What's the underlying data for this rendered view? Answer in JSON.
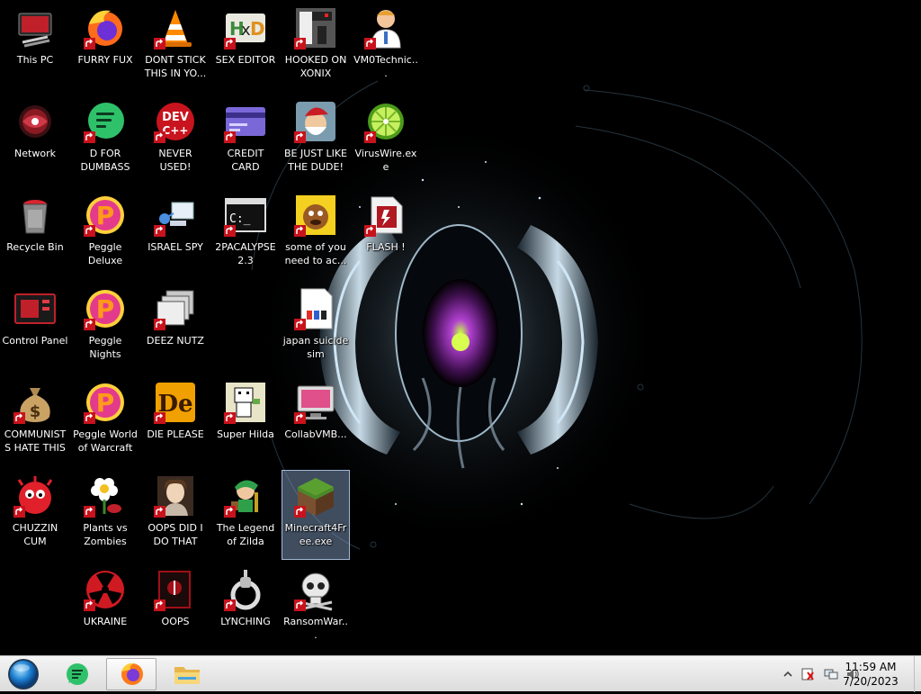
{
  "desktop": {
    "icons": [
      {
        "label": "This PC",
        "icon": "computer-icon"
      },
      {
        "label": "FURRY FUX",
        "icon": "firefox-icon"
      },
      {
        "label": "DONT STICK THIS IN YO...",
        "icon": "vlc-cone-icon"
      },
      {
        "label": "SEX EDITOR",
        "icon": "hxd-editor-icon"
      },
      {
        "label": "HOOKED ON XONIX",
        "icon": "xonix-game-icon"
      },
      {
        "label": "VM0Technic...",
        "icon": "doctor-icon"
      },
      {
        "label": "Network",
        "icon": "network-icon"
      },
      {
        "label": "D FOR DUMBASS",
        "icon": "green-chat-icon"
      },
      {
        "label": "NEVER USED!",
        "icon": "devcpp-icon"
      },
      {
        "label": "CREDIT CARD CHECKER",
        "icon": "credit-card-icon"
      },
      {
        "label": "BE JUST LIKE THE DUDE!",
        "icon": "santa-gnome-icon"
      },
      {
        "label": "VirusWire.exe",
        "icon": "lime-icon"
      },
      {
        "label": "Recycle Bin",
        "icon": "recycle-bin-icon"
      },
      {
        "label": "Peggle Deluxe",
        "icon": "peggle-icon"
      },
      {
        "label": "ISRAEL SPY",
        "icon": "network-share-icon"
      },
      {
        "label": "2PACALYPSE 2.3",
        "icon": "terminal-icon"
      },
      {
        "label": "some of you need to ac...",
        "icon": "cartoon-dog-icon"
      },
      {
        "label": "FLASH !",
        "icon": "flash-file-icon"
      },
      {
        "label": "Control Panel",
        "icon": "control-panel-icon"
      },
      {
        "label": "Peggle Nights Deluxe",
        "icon": "peggle-icon"
      },
      {
        "label": "DEEZ NUTZ",
        "icon": "windows-stack-icon"
      },
      {
        "label": "japan suicide sim",
        "icon": "document-icon"
      },
      {
        "label": "COMMUNISTS HATE THIS G...",
        "icon": "money-bag-icon"
      },
      {
        "label": "Peggle World of Warcraft ...",
        "icon": "peggle-icon"
      },
      {
        "label": "DIE PLEASE",
        "icon": "de-app-icon"
      },
      {
        "label": "Super Hilda",
        "icon": "pixel-character-icon"
      },
      {
        "label": "CollabVMB...",
        "icon": "monitor-icon"
      },
      {
        "label": "CHUZZIN CUM",
        "icon": "chuzzle-icon"
      },
      {
        "label": "Plants vs Zombies",
        "icon": "flower-icon"
      },
      {
        "label": "OOPS DID I DO THAT",
        "icon": "portrait-icon"
      },
      {
        "label": "The Legend of Zilda",
        "icon": "zelda-character-icon"
      },
      {
        "label": "Minecraft4Free.exe",
        "icon": "minecraft-grass-icon"
      },
      {
        "label": "UKRAINE",
        "icon": "radiation-icon"
      },
      {
        "label": "OOPS",
        "icon": "red-box-icon"
      },
      {
        "label": "LYNCHING",
        "icon": "noose-icon"
      },
      {
        "label": "RansomWar...",
        "icon": "skull-icon"
      }
    ]
  },
  "taskbar": {
    "start_icon": "start-orb-icon",
    "apps": [
      {
        "name": "chat-app",
        "icon": "green-chat-icon"
      },
      {
        "name": "firefox",
        "icon": "firefox-icon"
      },
      {
        "name": "file-explorer",
        "icon": "folder-icon"
      }
    ],
    "tray_icons": [
      "chevron-up-icon",
      "action-center-icon",
      "network-icon",
      "volume-icon"
    ],
    "clock": {
      "time": "11:59 AM",
      "date": "7/20/2023"
    }
  },
  "colors": {
    "taskbar_bg": "#e8e8e8",
    "selection": "#8caad2",
    "label_text": "#ffffff"
  }
}
